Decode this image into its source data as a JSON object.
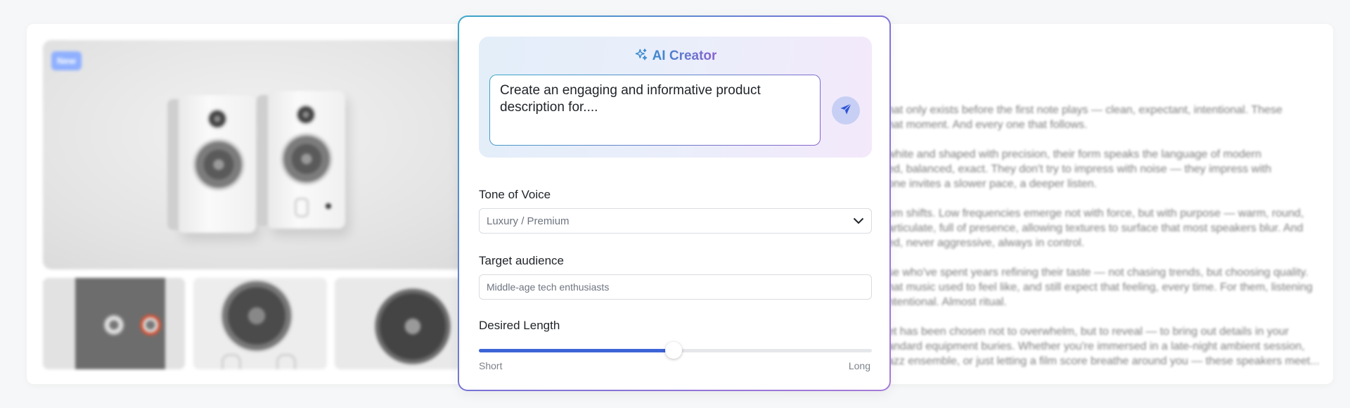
{
  "background_page": {
    "badge": "New",
    "description_lines": [
      "hat only exists before the first note plays — clean, expectant, intentional. These",
      "hat moment. And every one that follows.",
      "",
      "white and shaped with precision, their form speaks the language of modern",
      "ed, balanced, exact. They don't try to impress with noise — they impress with",
      "one invites a slower pace, a deeper listen.",
      "",
      "om shifts. Low frequencies emerge not with force, but with purpose — warm, round,",
      "articulate, full of presence, allowing textures to surface that most speakers blur. And",
      "ed, never aggressive, always in control.",
      "",
      "se who've spent years refining their taste — not chasing trends, but choosing quality.",
      "hat music used to feel like, and still expect that feeling, every time. For them, listening",
      "ntentional. Almost ritual.",
      "",
      "et has been chosen not to overwhelm, but to reveal — to bring out details in your",
      "andard equipment buries. Whether you're immersed in a late-night ambient session,",
      "azz ensemble, or just letting a film score breathe around you — these speakers meet..."
    ]
  },
  "ai_creator": {
    "title": "AI Creator",
    "title_icon": "sparkle-icon",
    "prompt_text": "Create an engaging and informative product description for....",
    "send_icon": "paper-plane-icon",
    "tone": {
      "label": "Tone of Voice",
      "selected": "Luxury / Premium"
    },
    "audience": {
      "label": "Target audience",
      "value": "Middle-age tech enthusiasts"
    },
    "length": {
      "label": "Desired Length",
      "min_label": "Short",
      "max_label": "Long",
      "value": 0.495
    },
    "colors": {
      "accent": "#3c64d6",
      "gradient_start": "#3aa6c9",
      "gradient_end": "#8a63cf"
    }
  }
}
